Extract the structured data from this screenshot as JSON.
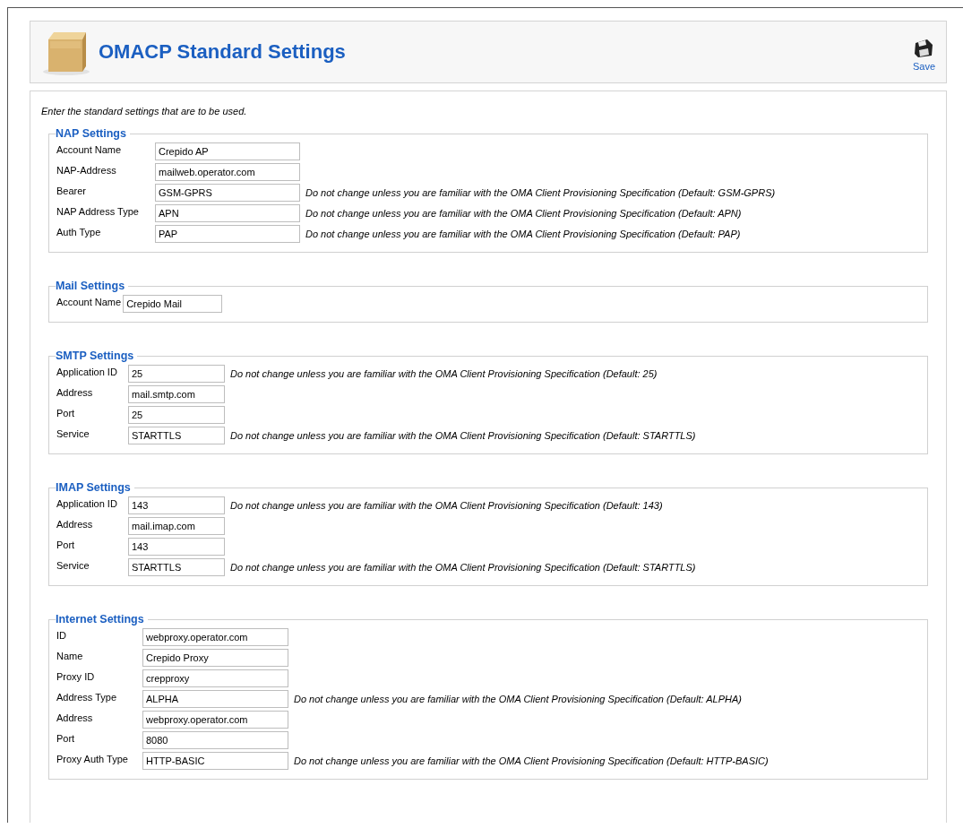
{
  "header": {
    "title": "OMACP Standard Settings",
    "save_label": "Save"
  },
  "intro": "Enter the standard settings that are to be used.",
  "sections": [
    {
      "legend": "NAP Settings",
      "rows": [
        {
          "label": "Account Name",
          "value": "Crepido AP"
        },
        {
          "label": "NAP-Address",
          "value": "mailweb.operator.com"
        },
        {
          "label": "Bearer",
          "value": "GSM-GPRS",
          "hint": "Do not change unless you are familiar with the OMA Client Provisioning Specification (Default: GSM-GPRS)"
        },
        {
          "label": "NAP Address Type",
          "value": "APN",
          "hint": "Do not change unless you are familiar with the OMA Client Provisioning Specification (Default: APN)"
        },
        {
          "label": "Auth Type",
          "value": "PAP",
          "hint": "Do not change unless you are familiar with the OMA Client Provisioning Specification (Default: PAP)"
        }
      ]
    },
    {
      "legend": "Mail Settings",
      "rows": [
        {
          "label": "Account Name",
          "value": "Crepido Mail"
        }
      ]
    },
    {
      "legend": "SMTP Settings",
      "rows": [
        {
          "label": "Application ID",
          "value": "25",
          "hint": "Do not change unless you are familiar with the OMA Client Provisioning Specification (Default: 25)"
        },
        {
          "label": "Address",
          "value": "mail.smtp.com"
        },
        {
          "label": "Port",
          "value": "25"
        },
        {
          "label": "Service",
          "value": "STARTTLS",
          "hint": "Do not change unless you are familiar with the OMA Client Provisioning Specification (Default: STARTTLS)"
        }
      ]
    },
    {
      "legend": "IMAP Settings",
      "rows": [
        {
          "label": "Application ID",
          "value": "143",
          "hint": "Do not change unless you are familiar with the OMA Client Provisioning Specification (Default: 143)"
        },
        {
          "label": "Address",
          "value": "mail.imap.com"
        },
        {
          "label": "Port",
          "value": "143"
        },
        {
          "label": "Service",
          "value": "STARTTLS",
          "hint": "Do not change unless you are familiar with the OMA Client Provisioning Specification (Default: STARTTLS)"
        }
      ]
    },
    {
      "legend": "Internet Settings",
      "rows": [
        {
          "label": "ID",
          "value": "webproxy.operator.com"
        },
        {
          "label": "Name",
          "value": "Crepido Proxy"
        },
        {
          "label": "Proxy ID",
          "value": "crepproxy"
        },
        {
          "label": "Address Type",
          "value": "ALPHA",
          "hint": "Do not change unless you are familiar with the OMA Client Provisioning Specification (Default: ALPHA)"
        },
        {
          "label": "Address",
          "value": "webproxy.operator.com"
        },
        {
          "label": "Port",
          "value": "8080"
        },
        {
          "label": "Proxy Auth Type",
          "value": "HTTP-BASIC",
          "hint": "Do not change unless you are familiar with the OMA Client Provisioning Specification (Default: HTTP-BASIC)"
        }
      ]
    }
  ]
}
